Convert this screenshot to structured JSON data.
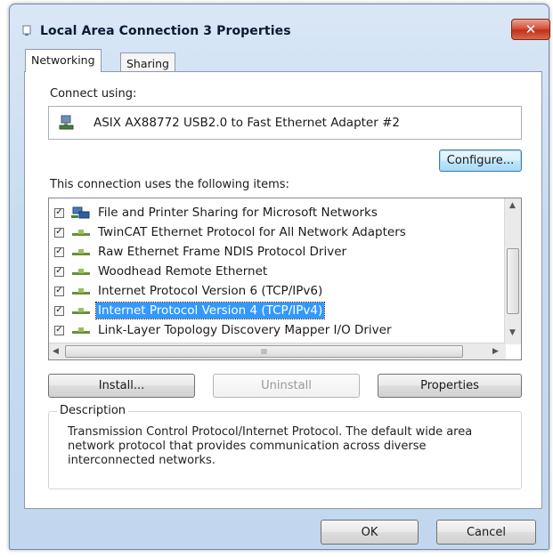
{
  "window": {
    "title": "Local Area Connection 3 Properties",
    "close_glyph": "✕"
  },
  "tabs": [
    {
      "label": "Networking",
      "active": true
    },
    {
      "label": "Sharing",
      "active": false
    }
  ],
  "connect_using": {
    "label": "Connect using:",
    "adapter": "ASIX AX88772 USB2.0 to Fast Ethernet Adapter #2",
    "configure_label": "Configure..."
  },
  "items": {
    "label": "This connection uses the following items:",
    "list": [
      {
        "label": "File and Printer Sharing for Microsoft Networks",
        "checked": true,
        "icon": "file-printer-sharing-icon"
      },
      {
        "label": "TwinCAT Ethernet Protocol for All Network Adapters",
        "checked": true,
        "icon": "network-protocol-icon"
      },
      {
        "label": "Raw Ethernet Frame NDIS Protocol Driver",
        "checked": true,
        "icon": "network-protocol-icon"
      },
      {
        "label": "Woodhead Remote Ethernet",
        "checked": true,
        "icon": "network-protocol-icon"
      },
      {
        "label": "Internet Protocol Version 6 (TCP/IPv6)",
        "checked": true,
        "icon": "network-protocol-icon"
      },
      {
        "label": "Internet Protocol Version 4 (TCP/IPv4)",
        "checked": true,
        "icon": "network-protocol-icon",
        "selected": true
      },
      {
        "label": "Link-Layer Topology Discovery Mapper I/O Driver",
        "checked": true,
        "icon": "network-protocol-icon"
      }
    ],
    "hscroll_grip": "III"
  },
  "buttons": {
    "install": "Install...",
    "uninstall": "Uninstall",
    "properties": "Properties",
    "ok": "OK",
    "cancel": "Cancel"
  },
  "description": {
    "label": "Description",
    "text": "Transmission Control Protocol/Internet Protocol. The default wide area network protocol that provides communication across diverse interconnected networks."
  },
  "colors": {
    "selection": "#3399ff",
    "close_button": "#c7402a",
    "frame": "#c8dcf1"
  }
}
